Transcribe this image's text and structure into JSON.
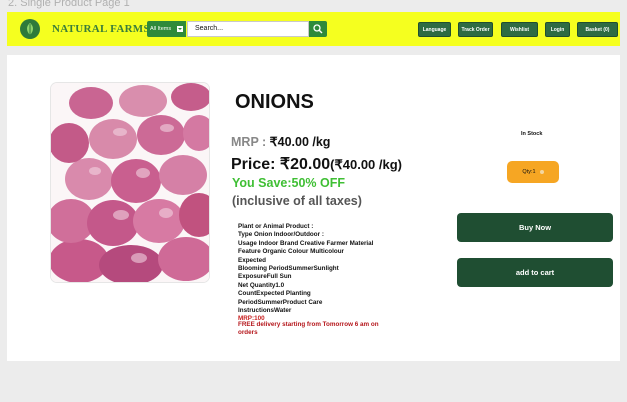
{
  "caption": "2. Single Product Page 1",
  "header": {
    "brand": "NATURAL FARMS",
    "category_select": "All Items",
    "search_value": "Search...",
    "nav": [
      "Language",
      "Track Order",
      "Wishlist",
      "Login",
      "Basket (0)"
    ]
  },
  "product": {
    "title": "ONIONS",
    "mrp_label": "MRP : ",
    "mrp_value": "₹40.00 /kg",
    "price_label": "Price: ₹20.00",
    "price_unit": "(₹40.00 /kg)",
    "savings": "You Save:50% OFF",
    "taxes_note": "(inclusive of all taxes)",
    "specs": [
      "Plant or Animal Product :",
      "Type Onion Indoor/Outdoor :",
      "Usage Indoor Brand Creative Farmer Material",
      "Feature  Organic Colour Multicolour",
      "Expected",
      "Blooming PeriodSummerSunlight",
      "ExposureFull Sun",
      "Net Quantity1.0",
      "CountExpected Planting",
      "PeriodSummerProduct Care",
      "InstructionsWater"
    ],
    "mrp_line": "MRP:100",
    "delivery_note": " FREE delivery starting from Tomorrow 6 am on orders",
    "stock_status": "In Stock",
    "qty_label": "Qty:1",
    "buy_now": "Buy Now",
    "add_to_cart": "add to cart"
  },
  "colors": {
    "header_bg": "#f5ff1f",
    "brand_green": "#2f8a3a",
    "button_dark": "#1f4e32",
    "savings_green": "#3fbf34",
    "qty_orange": "#f6a623",
    "delivery_red": "#b5161b"
  }
}
